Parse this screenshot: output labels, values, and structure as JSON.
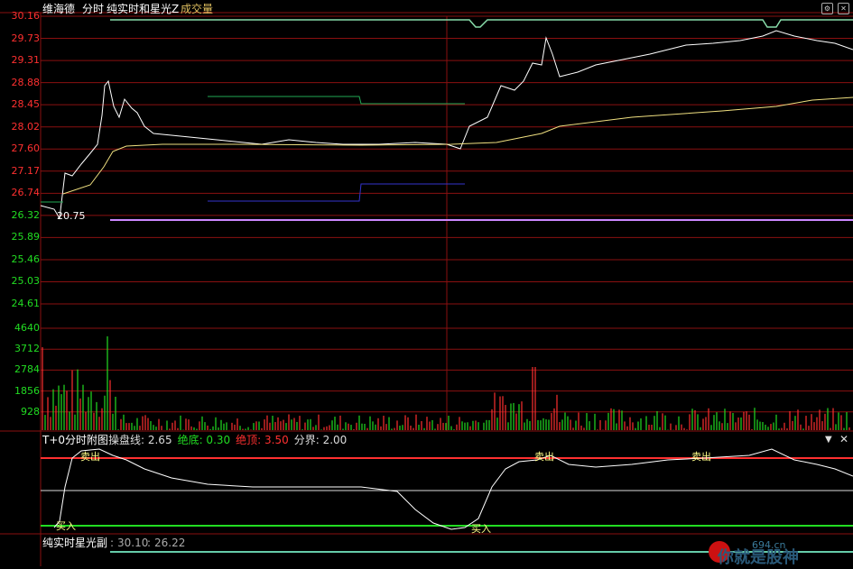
{
  "main_header": {
    "stock_name": "维海德",
    "mode": "分时",
    "indicator_name": "纯实时和星光Z",
    "volume_label": "成交量"
  },
  "header_icons": [
    "settings-icon",
    "close-icon"
  ],
  "price_axis": [
    "30.16",
    "29.73",
    "29.31",
    "28.88",
    "28.45",
    "28.02",
    "27.60",
    "27.17",
    "26.74",
    "26.32",
    "25.89",
    "25.46",
    "25.03",
    "24.61"
  ],
  "volume_axis": [
    "4640",
    "3712",
    "2784",
    "1856",
    "928"
  ],
  "low_price_marker": "20.75",
  "sub_panel": {
    "title": "T+0分时附图",
    "items": [
      {
        "label": "操盘线:",
        "value": "2.65",
        "color": "#dddddd"
      },
      {
        "label": "绝底:",
        "value": "0.30",
        "color": "#22dd22"
      },
      {
        "label": "绝顶:",
        "value": "3.50",
        "color": "#ff3030"
      },
      {
        "label": "分界:",
        "value": "2.00",
        "color": "#dddddd"
      }
    ],
    "signals": [
      "卖出",
      "卖出",
      "卖出",
      "买入",
      "买入"
    ],
    "dropdown_icon": "triangle-down-icon"
  },
  "bottom_panel": {
    "title": "纯实时星光副",
    "value1": "30.10",
    "value2": "26.22"
  },
  "watermark": {
    "site": "694.cn",
    "slogan": "你就是股神"
  },
  "colors": {
    "grid": "#8a1010",
    "price_up": "#ff3030",
    "price_down": "#22dd22",
    "white": "#ffffff",
    "avg_line": "#f0e080",
    "purple": "#cc88ff",
    "blue": "#3333cc"
  }
}
